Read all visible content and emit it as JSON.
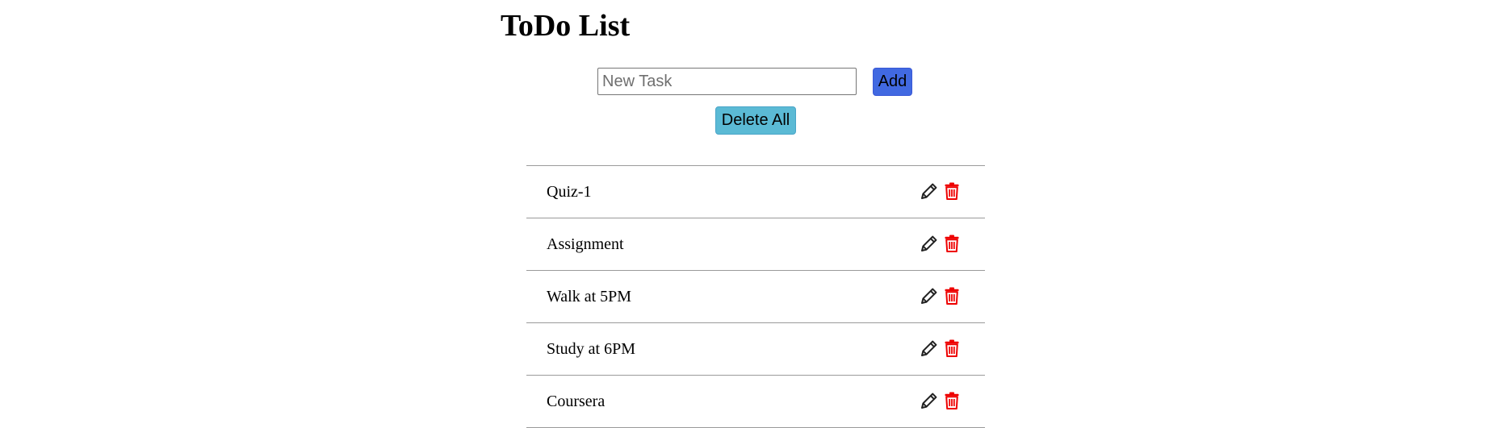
{
  "app": {
    "title": "ToDo List"
  },
  "form": {
    "input_placeholder": "New Task",
    "input_value": "",
    "add_label": "Add",
    "delete_all_label": "Delete All"
  },
  "tasks": [
    {
      "text": "Quiz-1",
      "edit_icon": "pencil-icon",
      "delete_icon": "trash-icon"
    },
    {
      "text": "Assignment",
      "edit_icon": "pencil-icon",
      "delete_icon": "trash-icon"
    },
    {
      "text": "Walk at 5PM",
      "edit_icon": "pencil-icon",
      "delete_icon": "trash-icon"
    },
    {
      "text": "Study at 6PM",
      "edit_icon": "pencil-icon",
      "delete_icon": "trash-icon"
    },
    {
      "text": "Coursera",
      "edit_icon": "pencil-icon",
      "delete_icon": "trash-icon"
    }
  ],
  "colors": {
    "add_button": "#4169e1",
    "delete_all_button": "#5bbad5",
    "edit_icon": "#222222",
    "delete_icon": "#ee0000",
    "divider": "#9a9a9a"
  }
}
